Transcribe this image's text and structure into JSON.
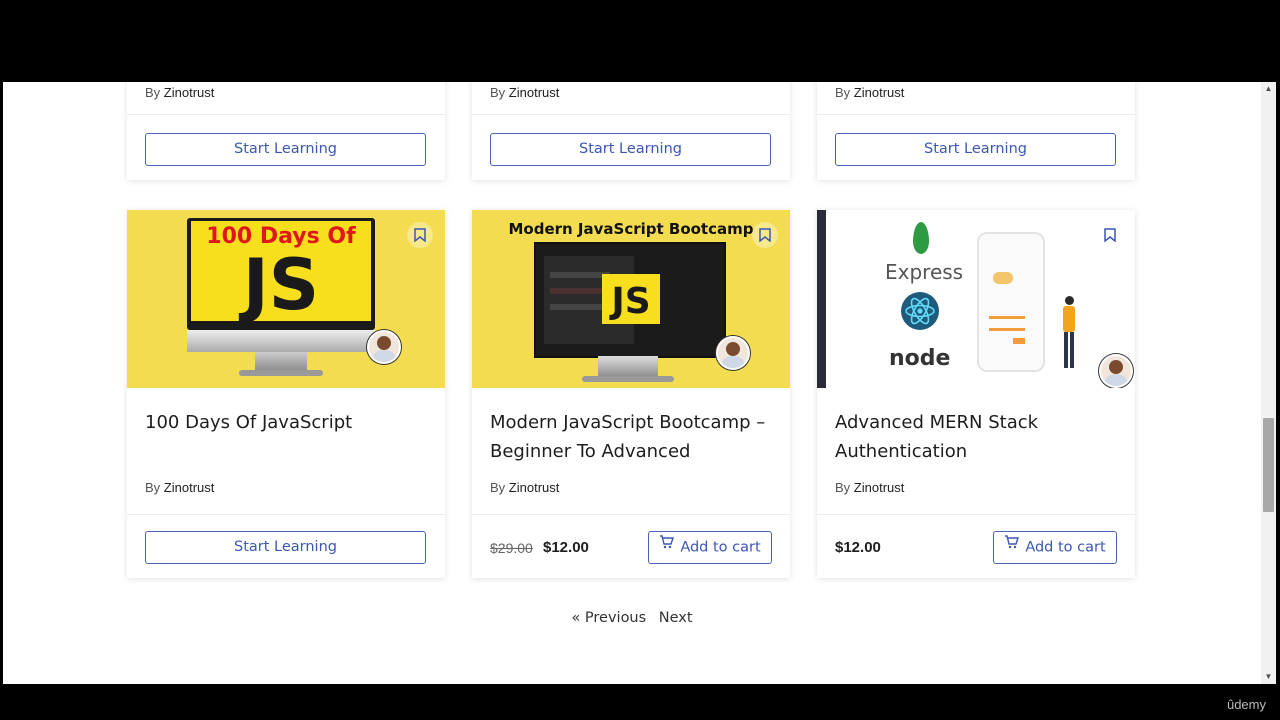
{
  "cards_top": [
    {
      "author_prefix": "By",
      "author": "Zinotrust",
      "button": "Start Learning"
    },
    {
      "author_prefix": "By",
      "author": "Zinotrust",
      "button": "Start Learning"
    },
    {
      "author_prefix": "By",
      "author": "Zinotrust",
      "button": "Start Learning"
    }
  ],
  "cards": [
    {
      "thumb_line1": "100 Days Of",
      "thumb_line2": "JS",
      "title": "100 Days Of JavaScript",
      "author_prefix": "By",
      "author": "Zinotrust",
      "button": "Start Learning"
    },
    {
      "thumb_title": "Modern JavaScript Bootcamp",
      "thumb_badge": "JS",
      "title": "Modern JavaScript Bootcamp – Beginner To Advanced",
      "author_prefix": "By",
      "author": "Zinotrust",
      "price_old": "$29.00",
      "price": "$12.00",
      "button": "Add to cart"
    },
    {
      "thumb_express": "Express",
      "thumb_node": "node",
      "title": "Advanced MERN Stack Authentication",
      "author_prefix": "By",
      "author": "Zinotrust",
      "price": "$12.00",
      "button": "Add to cart"
    }
  ],
  "pagination": {
    "previous": "« Previous",
    "next": "Next"
  },
  "brand_watermark": "ûdemy",
  "colors": {
    "accent": "#3c57b3",
    "thumb_yellow": "#f3dc4f",
    "js_yellow": "#f7df1e",
    "red_text": "#e0161d"
  }
}
